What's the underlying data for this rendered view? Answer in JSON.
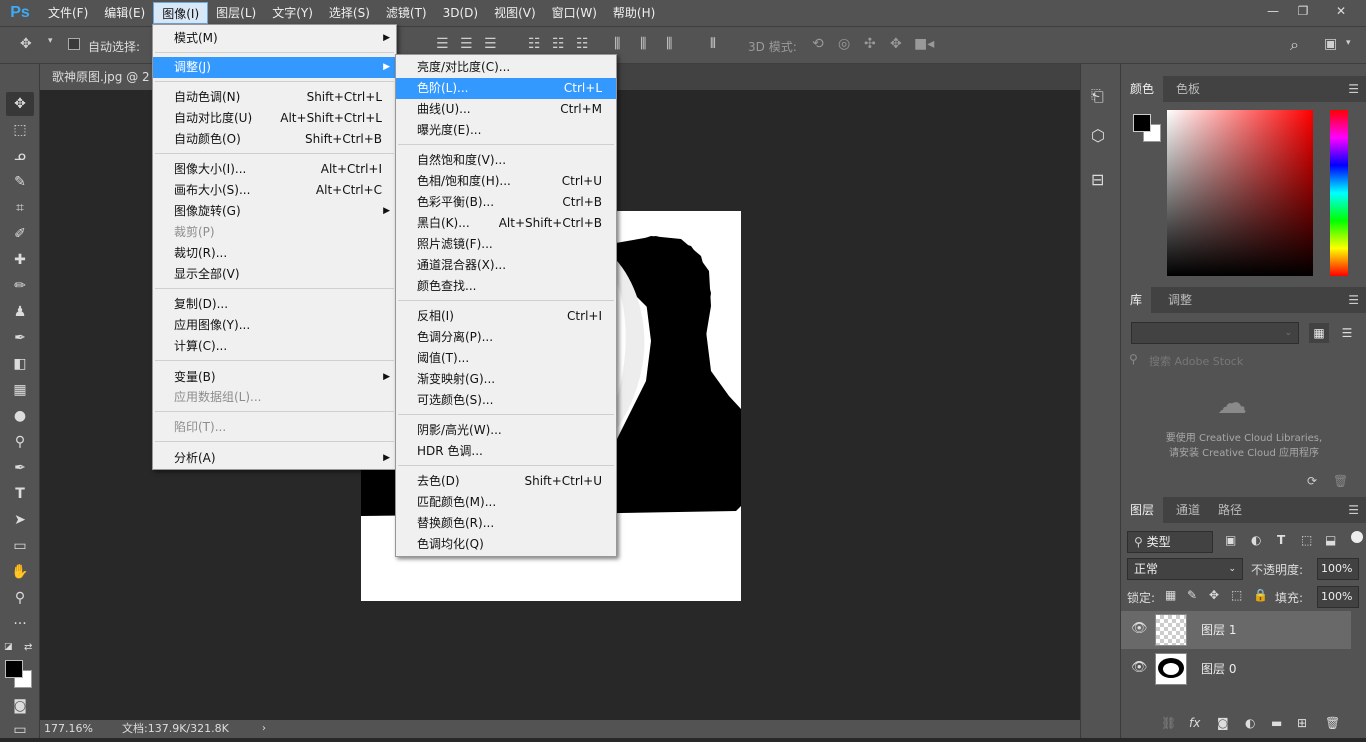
{
  "app": {
    "logo": "Ps",
    "menubar": [
      "文件(F)",
      "编辑(E)",
      "图像(I)",
      "图层(L)",
      "文字(Y)",
      "选择(S)",
      "滤镜(T)",
      "3D(D)",
      "视图(V)",
      "窗口(W)",
      "帮助(H)"
    ],
    "window_controls": [
      "—",
      "❐",
      "✕"
    ]
  },
  "options": {
    "auto_select": "自动选择:",
    "mode_3d": "3D 模式:"
  },
  "document": {
    "tab": "歌神原图.jpg @ 2",
    "zoom": "177.16%",
    "doc_size": "文档:137.9K/321.8K"
  },
  "image_menu": {
    "items": [
      {
        "label": "模式(M)",
        "shortcut": "",
        "submenu": true
      },
      {
        "label": "调整(J)",
        "shortcut": "",
        "submenu": true,
        "highlight": true
      },
      {
        "label": "自动色调(N)",
        "shortcut": "Shift+Ctrl+L"
      },
      {
        "label": "自动对比度(U)",
        "shortcut": "Alt+Shift+Ctrl+L"
      },
      {
        "label": "自动颜色(O)",
        "shortcut": "Shift+Ctrl+B"
      },
      {
        "label": "图像大小(I)...",
        "shortcut": "Alt+Ctrl+I"
      },
      {
        "label": "画布大小(S)...",
        "shortcut": "Alt+Ctrl+C"
      },
      {
        "label": "图像旋转(G)",
        "shortcut": "",
        "submenu": true
      },
      {
        "label": "裁剪(P)",
        "shortcut": "",
        "disabled": true
      },
      {
        "label": "裁切(R)...",
        "shortcut": ""
      },
      {
        "label": "显示全部(V)",
        "shortcut": ""
      },
      {
        "label": "复制(D)...",
        "shortcut": ""
      },
      {
        "label": "应用图像(Y)...",
        "shortcut": ""
      },
      {
        "label": "计算(C)...",
        "shortcut": ""
      },
      {
        "label": "变量(B)",
        "shortcut": "",
        "submenu": true
      },
      {
        "label": "应用数据组(L)...",
        "shortcut": "",
        "disabled": true
      },
      {
        "label": "陷印(T)...",
        "shortcut": "",
        "disabled": true
      },
      {
        "label": "分析(A)",
        "shortcut": "",
        "submenu": true
      }
    ]
  },
  "adjust_menu": {
    "items": [
      {
        "label": "亮度/对比度(C)...",
        "shortcut": ""
      },
      {
        "label": "色阶(L)...",
        "shortcut": "Ctrl+L",
        "highlight": true
      },
      {
        "label": "曲线(U)...",
        "shortcut": "Ctrl+M"
      },
      {
        "label": "曝光度(E)...",
        "shortcut": ""
      },
      {
        "label": "自然饱和度(V)...",
        "shortcut": ""
      },
      {
        "label": "色相/饱和度(H)...",
        "shortcut": "Ctrl+U"
      },
      {
        "label": "色彩平衡(B)...",
        "shortcut": "Ctrl+B"
      },
      {
        "label": "黑白(K)...",
        "shortcut": "Alt+Shift+Ctrl+B"
      },
      {
        "label": "照片滤镜(F)...",
        "shortcut": ""
      },
      {
        "label": "通道混合器(X)...",
        "shortcut": ""
      },
      {
        "label": "颜色查找...",
        "shortcut": ""
      },
      {
        "label": "反相(I)",
        "shortcut": "Ctrl+I"
      },
      {
        "label": "色调分离(P)...",
        "shortcut": ""
      },
      {
        "label": "阈值(T)...",
        "shortcut": ""
      },
      {
        "label": "渐变映射(G)...",
        "shortcut": ""
      },
      {
        "label": "可选颜色(S)...",
        "shortcut": ""
      },
      {
        "label": "阴影/高光(W)...",
        "shortcut": ""
      },
      {
        "label": "HDR 色调...",
        "shortcut": ""
      },
      {
        "label": "去色(D)",
        "shortcut": "Shift+Ctrl+U"
      },
      {
        "label": "匹配颜色(M)...",
        "shortcut": ""
      },
      {
        "label": "替换颜色(R)...",
        "shortcut": ""
      },
      {
        "label": "色调均化(Q)",
        "shortcut": ""
      }
    ]
  },
  "color_panel": {
    "tab_color": "颜色",
    "tab_swatches": "色板"
  },
  "library_panel": {
    "tab_library": "库",
    "tab_adjust": "调整",
    "search_placeholder": "搜索 Adobe Stock",
    "message_line1": "要使用 Creative Cloud Libraries,",
    "message_line2": "请安装 Creative Cloud 应用程序"
  },
  "layers_panel": {
    "tab_layers": "图层",
    "tab_channels": "通道",
    "tab_paths": "路径",
    "filter": "类型",
    "blend_mode": "正常",
    "opacity_label": "不透明度:",
    "opacity_value": "100%",
    "lock_label": "锁定:",
    "fill_label": "填充:",
    "fill_value": "100%",
    "layers": [
      {
        "name": "图层 1"
      },
      {
        "name": "图层 0"
      }
    ]
  },
  "colors": {
    "accent": "#3399ff",
    "panel": "#535353",
    "canvas": "#282828"
  }
}
